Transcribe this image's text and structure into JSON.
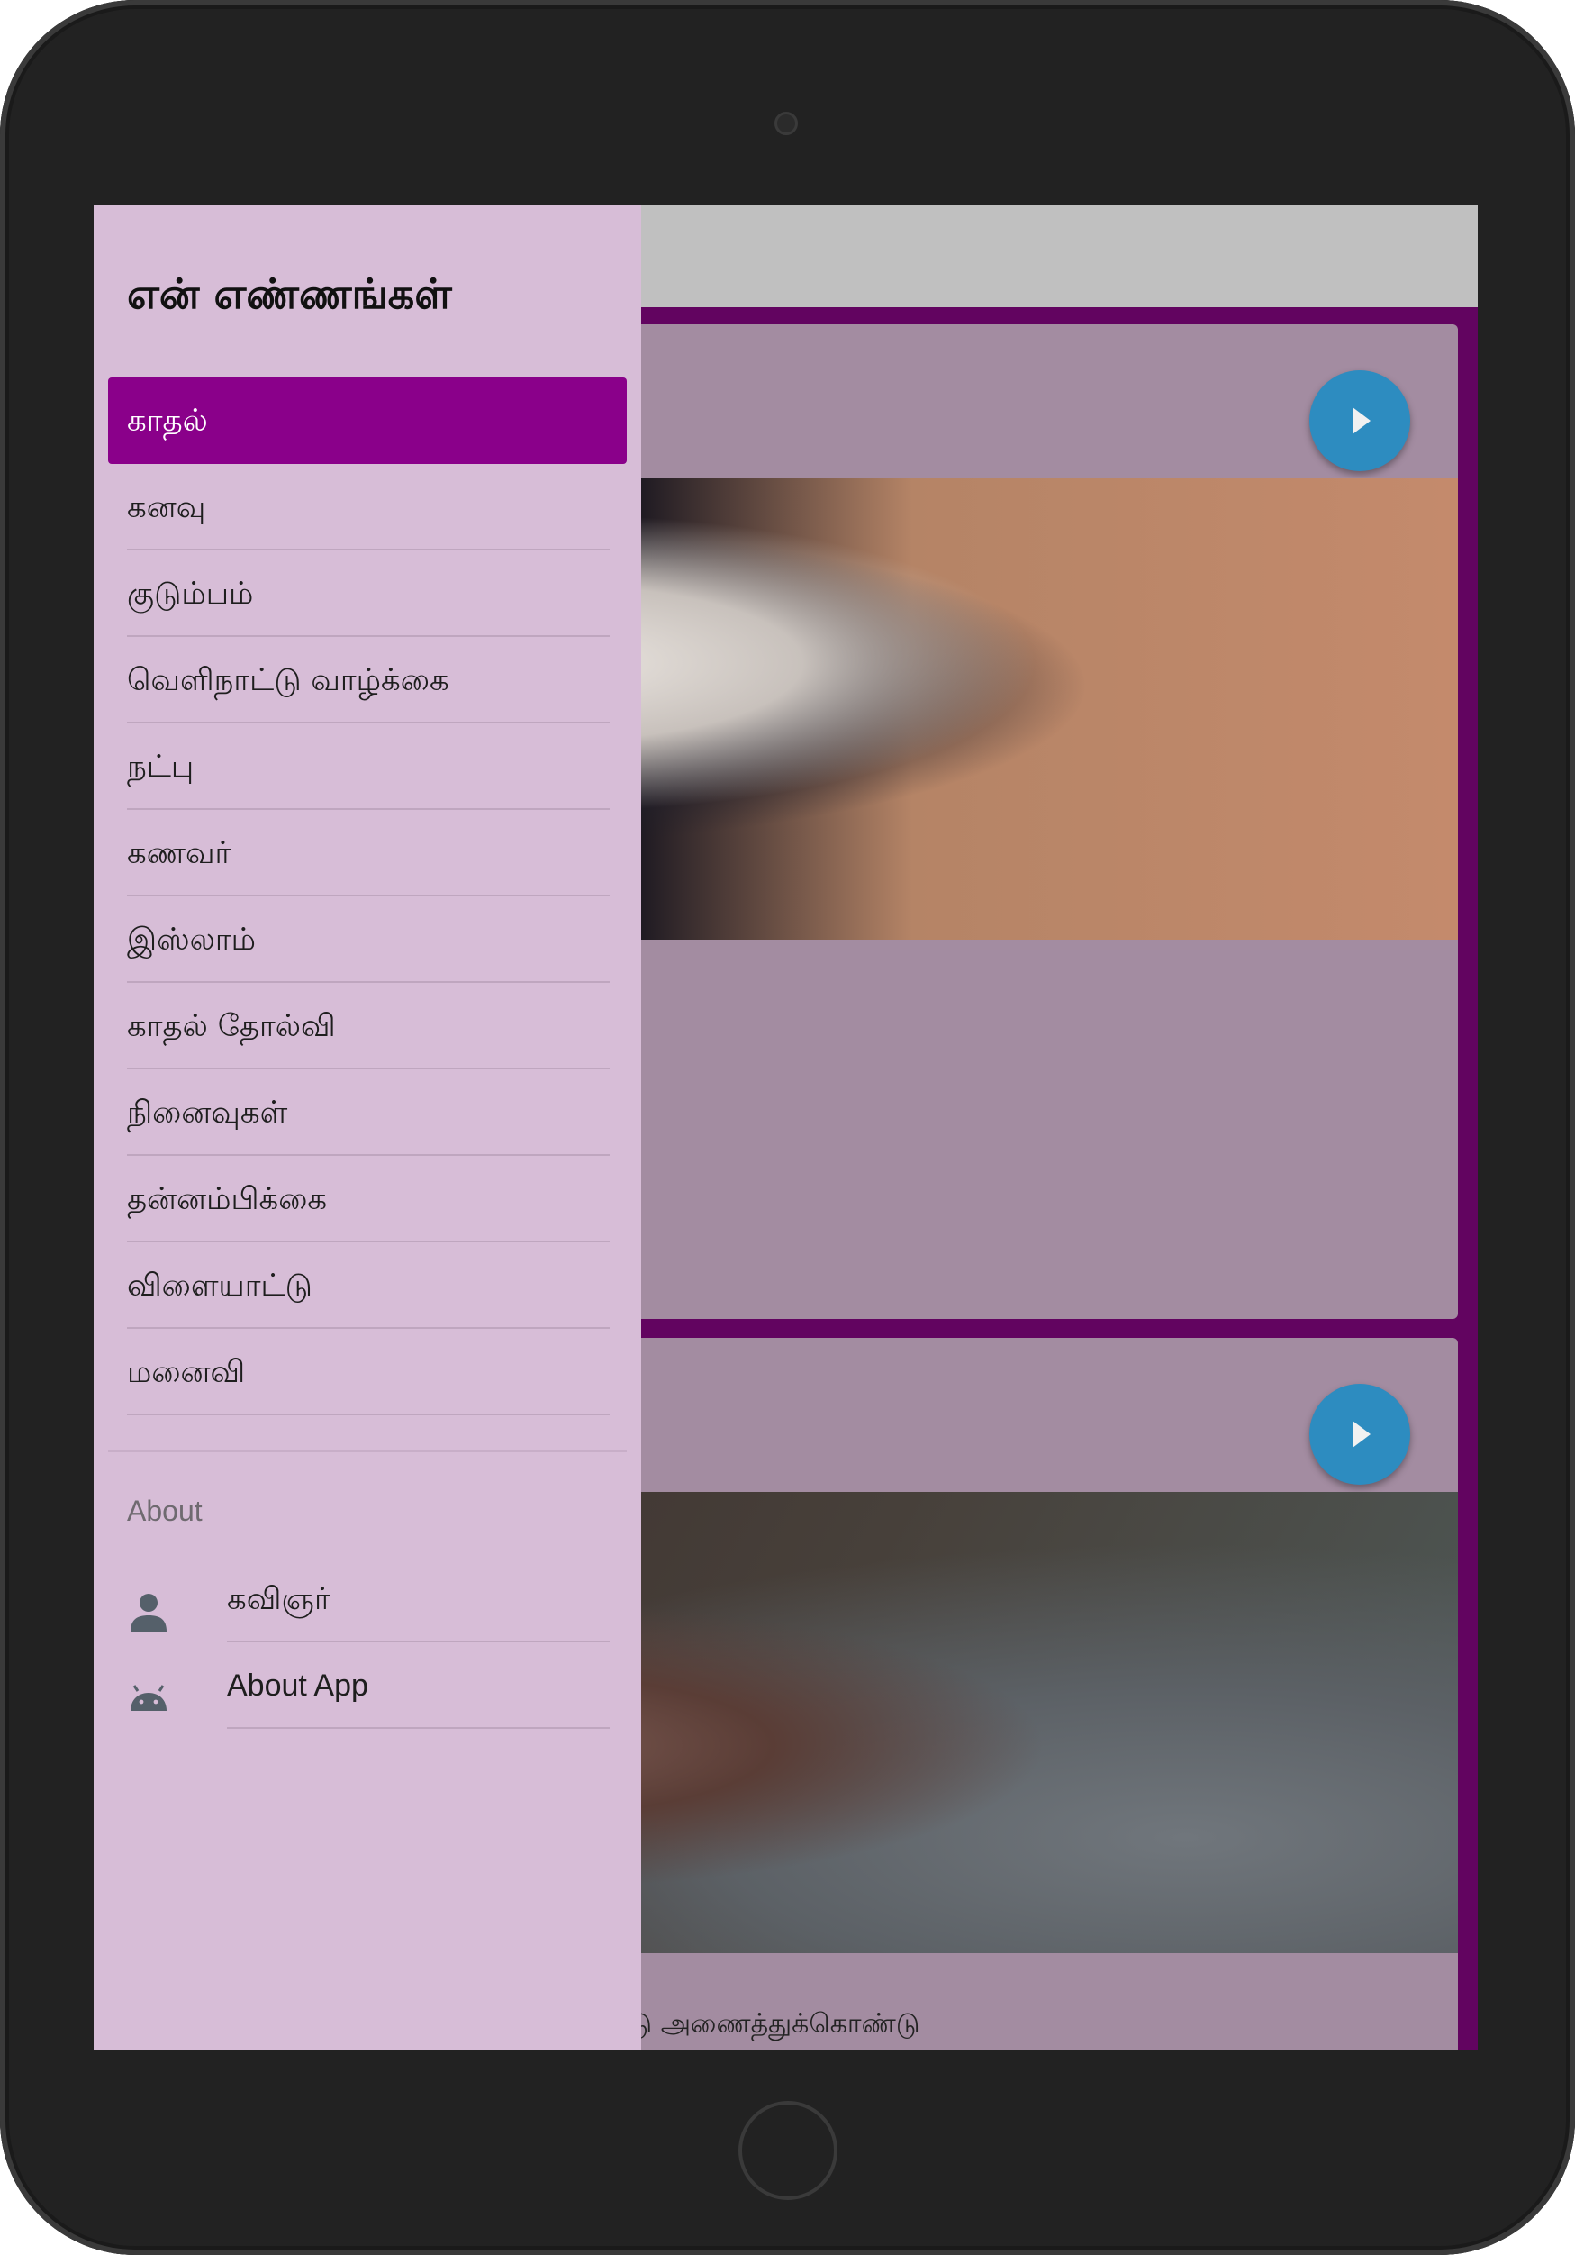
{
  "drawer": {
    "title": "என் எண்ணங்கள்",
    "items": [
      {
        "label": "காதல்",
        "active": true
      },
      {
        "label": "கனவு"
      },
      {
        "label": "குடும்பம்"
      },
      {
        "label": "வெளிநாட்டு வாழ்க்கை"
      },
      {
        "label": "நட்பு"
      },
      {
        "label": "கணவர்"
      },
      {
        "label": "இஸ்லாம்"
      },
      {
        "label": "காதல் தோல்வி"
      },
      {
        "label": "நினைவுகள்"
      },
      {
        "label": "தன்னம்பிக்கை"
      },
      {
        "label": "விளையாட்டு"
      },
      {
        "label": "மனைவி"
      }
    ],
    "section_label": "About",
    "about_items": [
      {
        "label": "கவிஞர்",
        "icon": "person-icon"
      },
      {
        "label": "About App",
        "icon": "android-icon"
      }
    ]
  },
  "content": {
    "card2_snippet": "மிட்டு அணைத்துக்கொண்டு"
  },
  "colors": {
    "drawer_bg": "#d7bdd7",
    "active_item": "#8a008a",
    "list_bg": "#620460",
    "card_bg": "#a38ca1",
    "play_button": "#2d8cc0"
  }
}
